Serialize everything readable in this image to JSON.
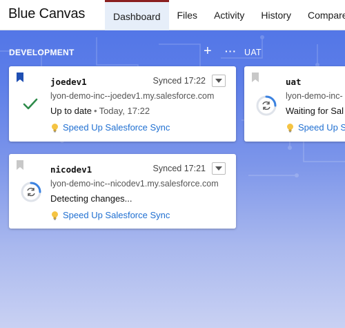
{
  "app": {
    "title": "Blue Canvas"
  },
  "nav": {
    "tabs": [
      {
        "label": "Dashboard",
        "active": true
      },
      {
        "label": "Files",
        "active": false
      },
      {
        "label": "Activity",
        "active": false
      },
      {
        "label": "History",
        "active": false
      },
      {
        "label": "Compare",
        "active": false
      }
    ]
  },
  "sections": {
    "development": {
      "label": "DEVELOPMENT",
      "add_label": "+",
      "more_label": "···"
    },
    "uat": {
      "label": "UAT"
    }
  },
  "cards": {
    "joedev1": {
      "name": "joedev1",
      "synced": "Synced 17:22",
      "host": "lyon-demo-inc--joedev1.my.salesforce.com",
      "status": "Up to date",
      "status_time": "Today, 17:22",
      "link": "Speed Up Salesforce Sync",
      "bookmark_color": "#1f4fb3",
      "status_icon": "check-icon"
    },
    "uat": {
      "name": "uat",
      "host": "lyon-demo-inc-",
      "status": "Waiting for Sal",
      "link": "Speed Up Sal",
      "bookmark_color": "#c8c8c8",
      "status_icon": "sync-icon"
    },
    "nicodev1": {
      "name": "nicodev1",
      "synced": "Synced 17:21",
      "host": "lyon-demo-inc--nicodev1.my.salesforce.com",
      "status": "Detecting changes...",
      "link": "Speed Up Salesforce Sync",
      "bookmark_color": "#c8c8c8",
      "status_icon": "sync-icon"
    }
  },
  "colors": {
    "accent_tab": "#8a1f1f",
    "link": "#1f6fd1",
    "check": "#2e8b4a",
    "sync_ring": "#3b82e0"
  }
}
